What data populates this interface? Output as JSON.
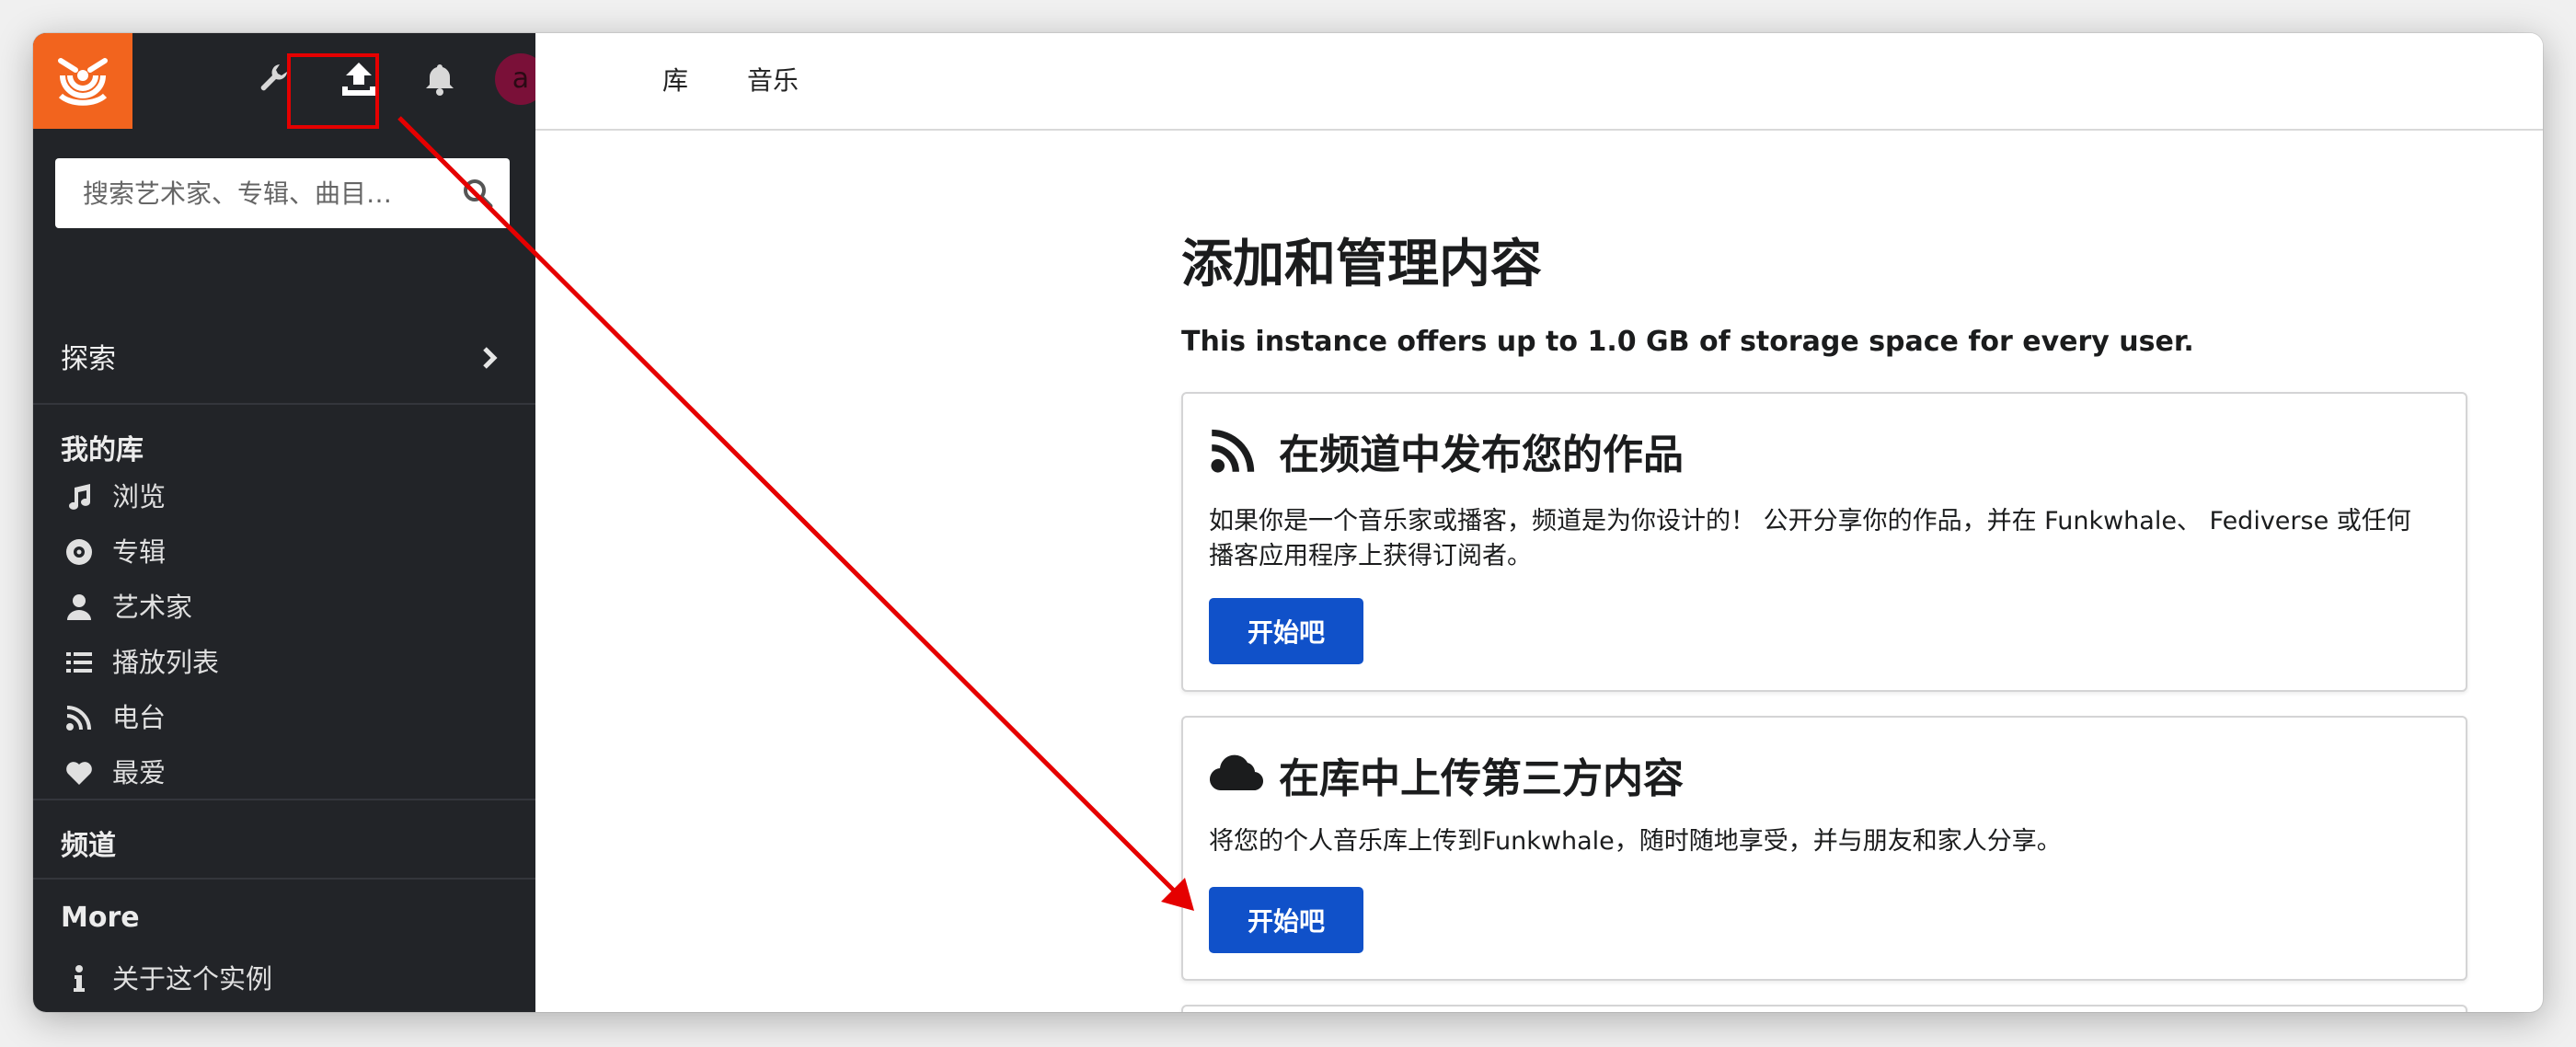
{
  "sidebar": {
    "search_placeholder": "搜索艺术家、专辑、曲目…",
    "avatar_initial": "a",
    "explore_label": "探索",
    "library_heading": "我的库",
    "library_items": [
      {
        "label": "浏览",
        "icon": "music-note-icon"
      },
      {
        "label": "专辑",
        "icon": "disc-icon"
      },
      {
        "label": "艺术家",
        "icon": "user-icon"
      },
      {
        "label": "播放列表",
        "icon": "list-icon"
      },
      {
        "label": "电台",
        "icon": "feed-icon"
      },
      {
        "label": "最爱",
        "icon": "heart-icon"
      }
    ],
    "channels_heading": "频道",
    "more_heading": "More",
    "more_items": [
      {
        "label": "关于这个实例",
        "icon": "info-icon"
      }
    ]
  },
  "topnav": {
    "tabs": [
      "库",
      "音乐"
    ]
  },
  "main": {
    "title": "添加和管理内容",
    "storage_note": "This instance offers up to 1.0 GB of storage space for every user.",
    "cards": [
      {
        "title": "在频道中发布您的作品",
        "icon": "feed-icon",
        "description": "如果你是一个音乐家或播客，频道是为你设计的！ 公开分享你的作品，并在 Funkwhale、 Fediverse 或任何播客应用程序上获得订阅者。",
        "button": "开始吧"
      },
      {
        "title": "在库中上传第三方内容",
        "icon": "cloud-icon",
        "description": "将您的个人音乐库上传到Funkwhale，随时随地享受，并与朋友和家人分享。",
        "button": "开始吧"
      }
    ]
  },
  "colors": {
    "brand": "#f2641e",
    "sidebar_bg": "#222428",
    "primary_button": "#1051c9",
    "annotation": "#e50000"
  }
}
